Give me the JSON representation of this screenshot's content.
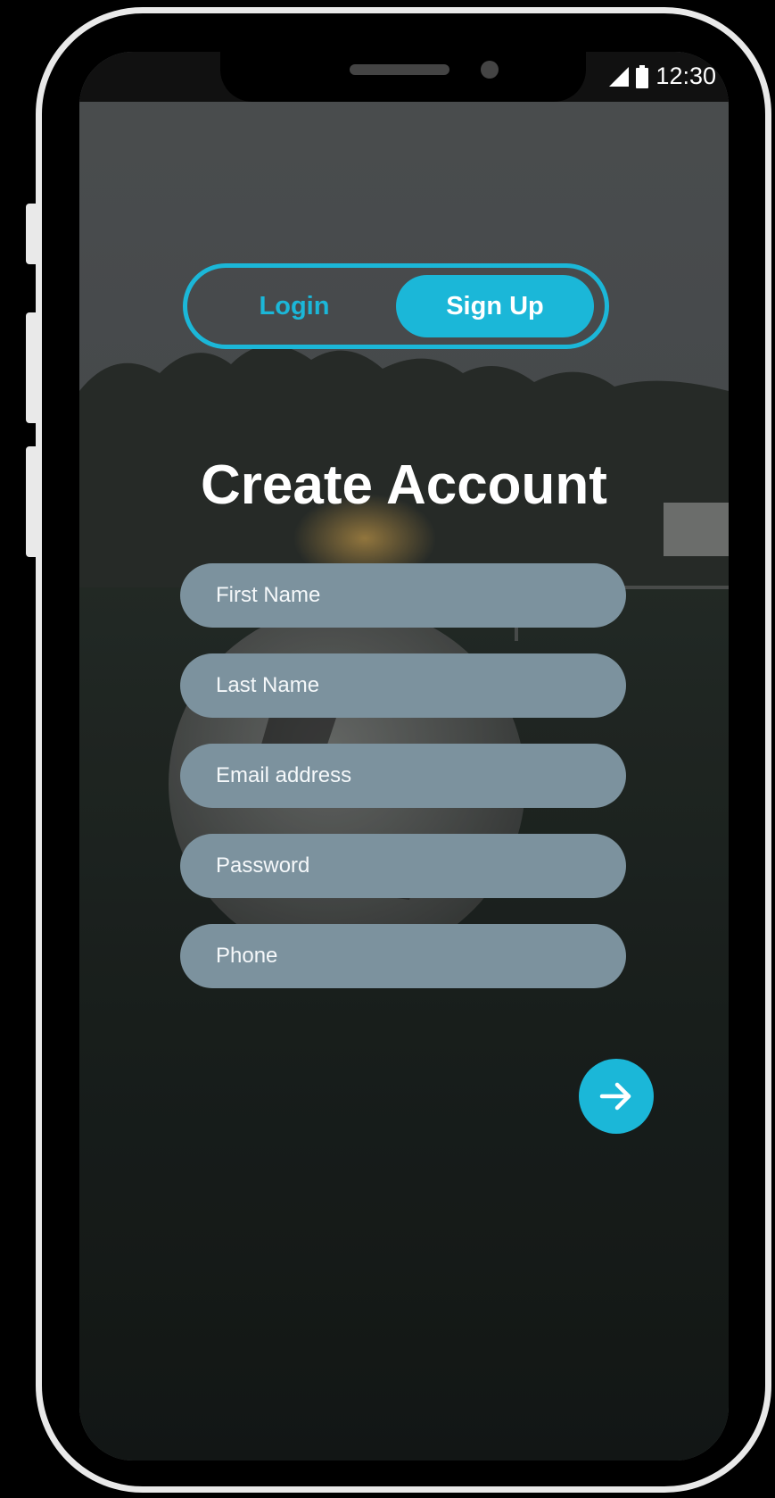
{
  "status_bar": {
    "time": "12:30",
    "signal_icon": "signal-icon",
    "battery_icon": "battery-icon"
  },
  "auth_toggle": {
    "login_label": "Login",
    "signup_label": "Sign Up",
    "active": "Sign Up"
  },
  "form": {
    "title": "Create Account",
    "fields": [
      {
        "placeholder": "First Name",
        "value": ""
      },
      {
        "placeholder": "Last Name",
        "value": ""
      },
      {
        "placeholder": "Email address",
        "value": ""
      },
      {
        "placeholder": "Password",
        "value": ""
      },
      {
        "placeholder": "Phone",
        "value": ""
      }
    ],
    "submit_icon": "arrow-right-icon"
  },
  "colors": {
    "accent": "#1bb7d8",
    "field_bg": "#7c929e",
    "text": "#ffffff"
  }
}
